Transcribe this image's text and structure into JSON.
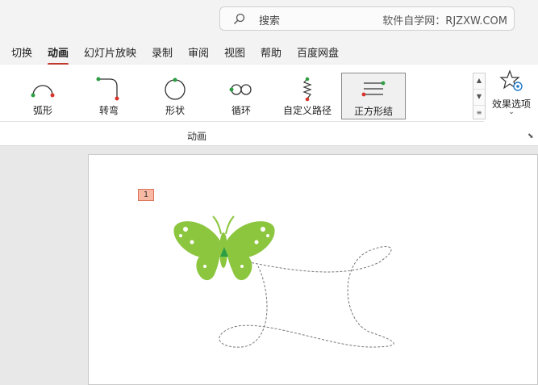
{
  "search": {
    "placeholder": "搜索",
    "watermark": "软件自学网：RJZXW.COM",
    "icon": "search-icon"
  },
  "tabs": [
    {
      "label": "切换",
      "active": false
    },
    {
      "label": "动画",
      "active": true
    },
    {
      "label": "幻灯片放映",
      "active": false
    },
    {
      "label": "录制",
      "active": false
    },
    {
      "label": "审阅",
      "active": false
    },
    {
      "label": "视图",
      "active": false
    },
    {
      "label": "帮助",
      "active": false
    },
    {
      "label": "百度网盘",
      "active": false
    }
  ],
  "ribbon": {
    "paths": [
      {
        "label": "弧形",
        "icon": "arc-path-icon"
      },
      {
        "label": "转弯",
        "icon": "turn-path-icon"
      },
      {
        "label": "形状",
        "icon": "shape-path-icon"
      },
      {
        "label": "循环",
        "icon": "loop-path-icon"
      },
      {
        "label": "自定义路径",
        "icon": "custom-path-icon"
      },
      {
        "label": "正方形结",
        "icon": "square-knot-path-icon",
        "selected": true
      }
    ],
    "group_label": "动画",
    "effect_options_label": "效果选项"
  },
  "slide": {
    "animation_number": "1"
  },
  "colors": {
    "accent": "#c0392b",
    "butterfly": "#8cc63f",
    "path_start": "#2e9e44",
    "path_end": "#d9342b"
  }
}
